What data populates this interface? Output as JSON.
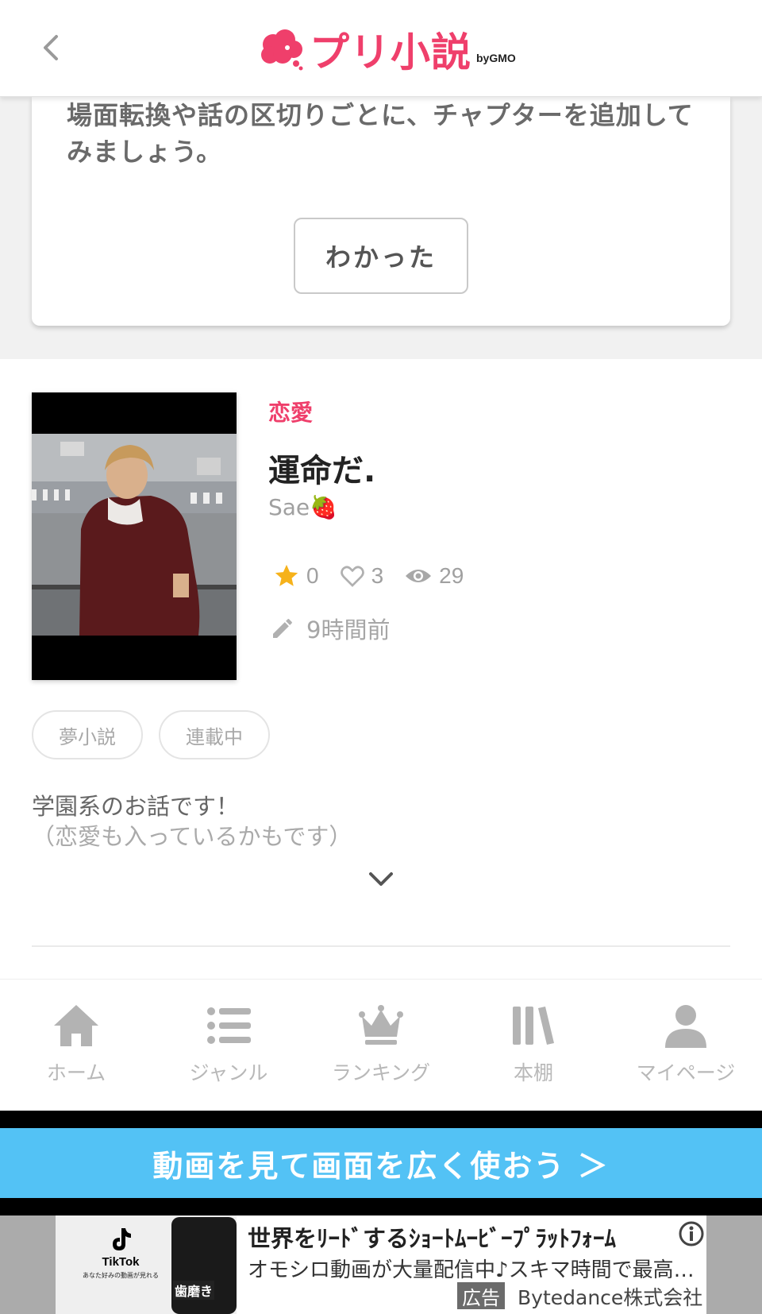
{
  "header": {
    "logo_text": "プリ小説",
    "logo_by": "by",
    "logo_brand": "GMO"
  },
  "tip": {
    "text": "場面転換や話の区切りごとに、チャプターを追加してみましょう。",
    "button_label": "わかった"
  },
  "work": {
    "genre": "恋愛",
    "title": "運命だ.",
    "author": "Sae🍓",
    "stars": "0",
    "likes": "3",
    "views": "29",
    "updated": "9時間前",
    "tags": [
      "夢小説",
      "連載中"
    ],
    "description_line1": "学園系のお話です！",
    "description_line2": "（恋愛も入っているかもです）"
  },
  "bottom_nav": {
    "items": [
      {
        "label": "ホーム",
        "icon": "home-icon"
      },
      {
        "label": "ジャンル",
        "icon": "list-icon"
      },
      {
        "label": "ランキング",
        "icon": "crown-icon"
      },
      {
        "label": "本棚",
        "icon": "bookshelf-icon"
      },
      {
        "label": "マイページ",
        "icon": "person-icon"
      }
    ]
  },
  "video_banner": {
    "label": "動画を見て画面を広く使おう ＞"
  },
  "ad": {
    "title": "世界をﾘｰﾄﾞするｼｮｰﾄﾑｰﾋﾞｰﾌﾟﾗｯﾄﾌｫｰﾑ",
    "text": "オモシロ動画が大量配信中♪スキマ時間で最高…",
    "badge": "広告",
    "advertiser": "Bytedance株式会社",
    "thumb_brand": "TikTok",
    "thumb_sub": "あなた好みの動画が見れる",
    "thumb_overlay": "歯磨き"
  },
  "colors": {
    "brand_pink": "#ef3f6b",
    "banner_blue": "#53c2f5",
    "star_gold": "#f6b21b"
  }
}
